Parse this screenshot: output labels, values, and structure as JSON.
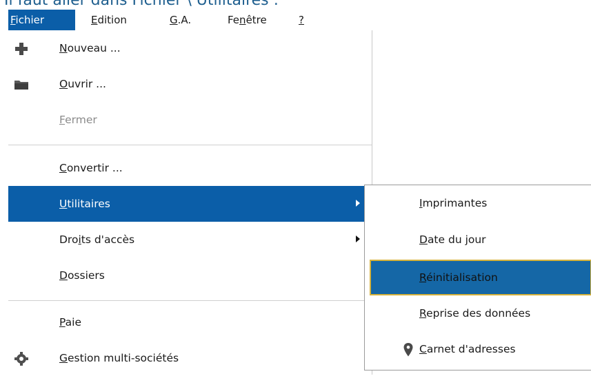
{
  "caption": "Il faut aller dans Fichier \\ Utilitaires :",
  "menubar": {
    "items": [
      {
        "prefix": "",
        "key": "F",
        "suffix": "ichier"
      },
      {
        "prefix": "",
        "key": "E",
        "suffix": "dition"
      },
      {
        "prefix": "",
        "key": "G",
        "suffix": ".A."
      },
      {
        "prefix": "Fe",
        "key": "n",
        "suffix": "être"
      },
      {
        "prefix": "",
        "key": "?",
        "suffix": ""
      }
    ]
  },
  "file_menu": {
    "items": [
      {
        "prefix": "",
        "key": "N",
        "suffix": "ouveau ...",
        "icon": "plus-icon"
      },
      {
        "prefix": "",
        "key": "O",
        "suffix": "uvrir ...",
        "icon": "folder-icon"
      },
      {
        "prefix": "",
        "key": "F",
        "suffix": "ermer"
      },
      {
        "prefix": "",
        "key": "C",
        "suffix": "onvertir ..."
      },
      {
        "prefix": "",
        "key": "U",
        "suffix": "tilitaires"
      },
      {
        "prefix": "Dro",
        "key": "i",
        "suffix": "ts d'accès"
      },
      {
        "prefix": "",
        "key": "D",
        "suffix": "ossiers"
      },
      {
        "prefix": "",
        "key": "P",
        "suffix": "aie"
      },
      {
        "prefix": "",
        "key": "G",
        "suffix": "estion multi-sociétés",
        "icon": "gear-icon"
      }
    ]
  },
  "utilitaires_submenu": {
    "items": [
      {
        "prefix": "",
        "key": "I",
        "suffix": "mprimantes"
      },
      {
        "prefix": "",
        "key": "D",
        "suffix": "ate du jour"
      },
      {
        "prefix": "",
        "key": "R",
        "suffix": "éinitialisation"
      },
      {
        "prefix": "",
        "key": "R",
        "suffix": "eprise des données"
      },
      {
        "prefix": "",
        "key": "C",
        "suffix": "arnet d'adresses",
        "icon": "map-pin-icon"
      }
    ]
  },
  "colors": {
    "highlight": "#0b5ea8",
    "selected_border": "#d6b23a",
    "caption": "#1f5f8f"
  }
}
